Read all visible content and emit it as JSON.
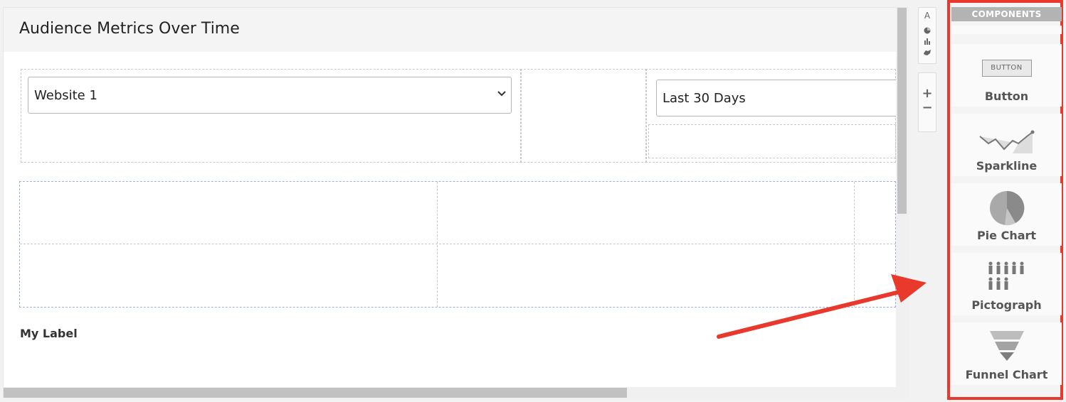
{
  "panel": {
    "title": "Audience Metrics Over Time"
  },
  "filters": {
    "website_select_value": "Website 1",
    "date_range_value": "Last 30 Days"
  },
  "canvas": {
    "label_text": "My Label"
  },
  "mini_toolbar": {
    "text_glyph": "A",
    "plus_glyph": "+",
    "minus_glyph": "−"
  },
  "components": {
    "header": "COMPONENTS",
    "items": [
      {
        "label": "Button",
        "icon": "button-icon",
        "icon_text": "BUTTON"
      },
      {
        "label": "Sparkline",
        "icon": "sparkline-icon"
      },
      {
        "label": "Pie Chart",
        "icon": "pie-chart-icon"
      },
      {
        "label": "Pictograph",
        "icon": "pictograph-icon"
      },
      {
        "label": "Funnel Chart",
        "icon": "funnel-chart-icon"
      }
    ]
  },
  "colors": {
    "highlight": "#e8392c",
    "icon_gray": "#888888"
  }
}
